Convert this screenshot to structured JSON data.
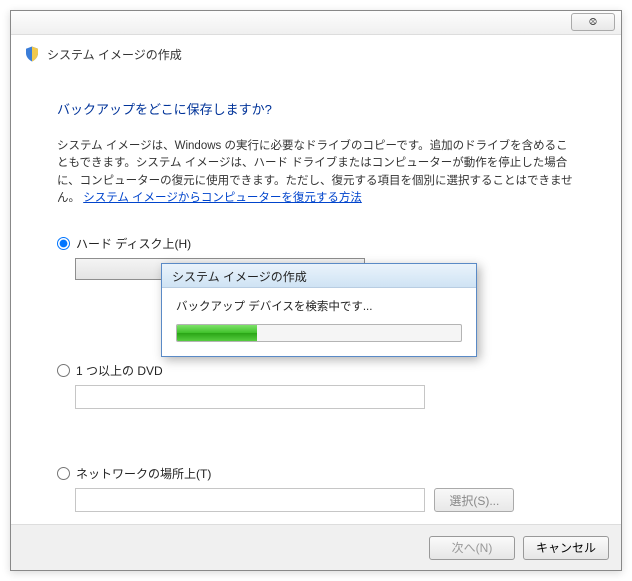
{
  "window": {
    "close_symbol": "⮾"
  },
  "header": {
    "title": "システム イメージの作成"
  },
  "main": {
    "question": "バックアップをどこに保存しますか?",
    "description": "システム イメージは、Windows の実行に必要なドライブのコピーです。追加のドライブを含めることもできます。システム イメージは、ハード ドライブまたはコンピューターが動作を停止した場合に、コンピューターの復元に使用できます。ただし、復元する項目を個別に選択することはできません。",
    "link_text": "システム イメージからコンピューターを復元する方法"
  },
  "options": {
    "hard_disk": {
      "label": "ハード ディスク上(H)",
      "selected": true
    },
    "dvd": {
      "label": "1 つ以上の DVD",
      "selected": false
    },
    "network": {
      "label": "ネットワークの場所上(T)",
      "selected": false
    },
    "select_button": "選択(S)..."
  },
  "footer": {
    "next": "次へ(N)",
    "cancel": "キャンセル"
  },
  "modal": {
    "title": "システム イメージの作成",
    "status": "バックアップ デバイスを検索中です...",
    "progress_percent": 28
  }
}
